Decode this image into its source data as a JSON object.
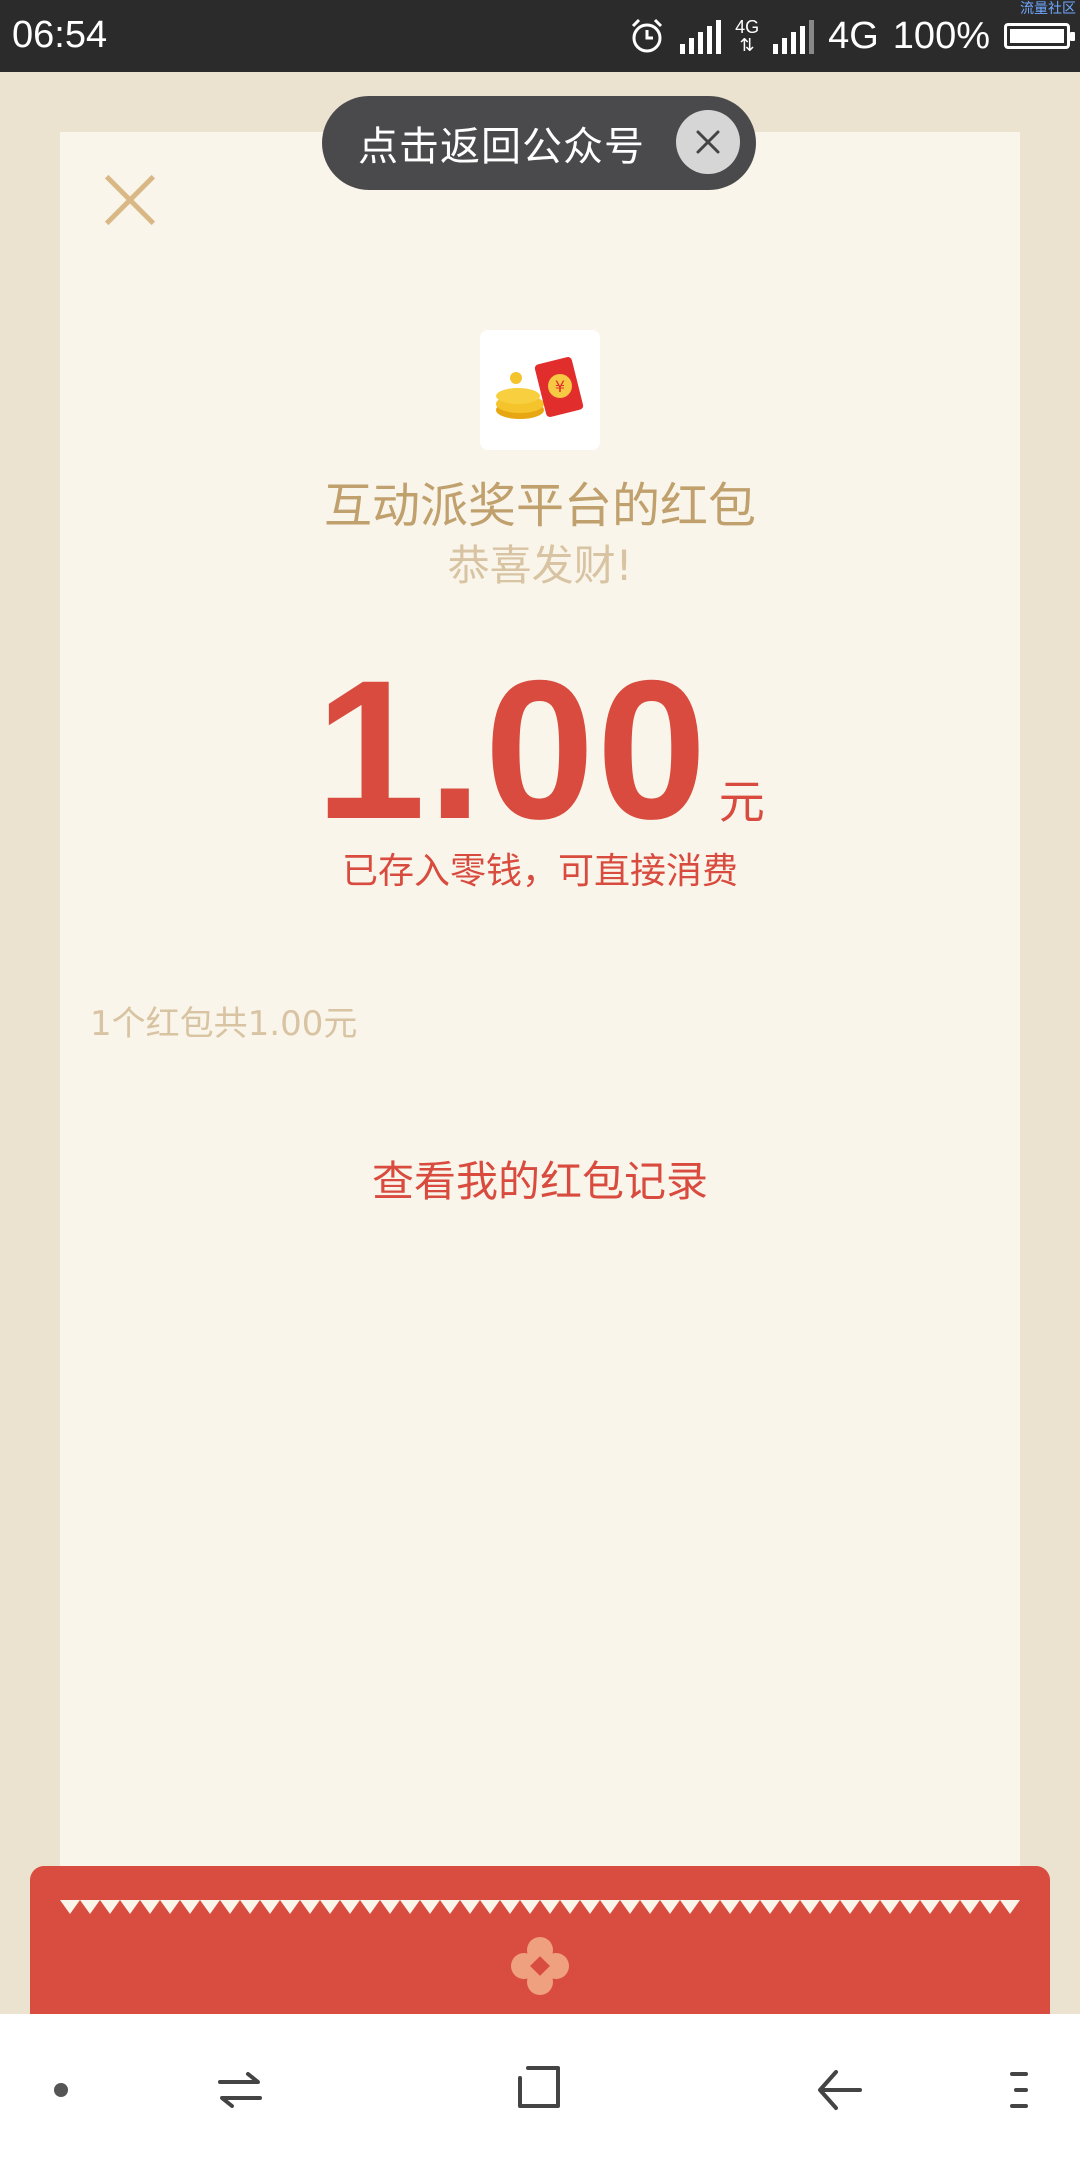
{
  "status_bar": {
    "time": "06:54",
    "network_small": "4G",
    "network": "4G",
    "battery": "100%",
    "watermark": "流量社区"
  },
  "toast": {
    "text": "点击返回公众号",
    "close_icon": "close-icon"
  },
  "packet": {
    "close_icon": "close-icon",
    "logo_icon": "red-envelope-coins-icon",
    "sender": "互动派奖平台的红包",
    "greeting": "恭喜发财!",
    "amount": "1.00",
    "unit": "元",
    "stored_text": "已存入零钱，可直接消费",
    "summary": "1个红包共1.00元",
    "record_link": "查看我的红包记录"
  },
  "nav_bar": {
    "items": [
      "dot-icon",
      "switch-icon",
      "home-square-icon",
      "back-icon",
      "menu-icon"
    ]
  },
  "colors": {
    "accent_red": "#d84b3e",
    "gold": "#c0a06d",
    "pale_gold": "#d8c3a2",
    "card_bg": "#faf5ea",
    "page_bg": "#ebe3d0"
  }
}
